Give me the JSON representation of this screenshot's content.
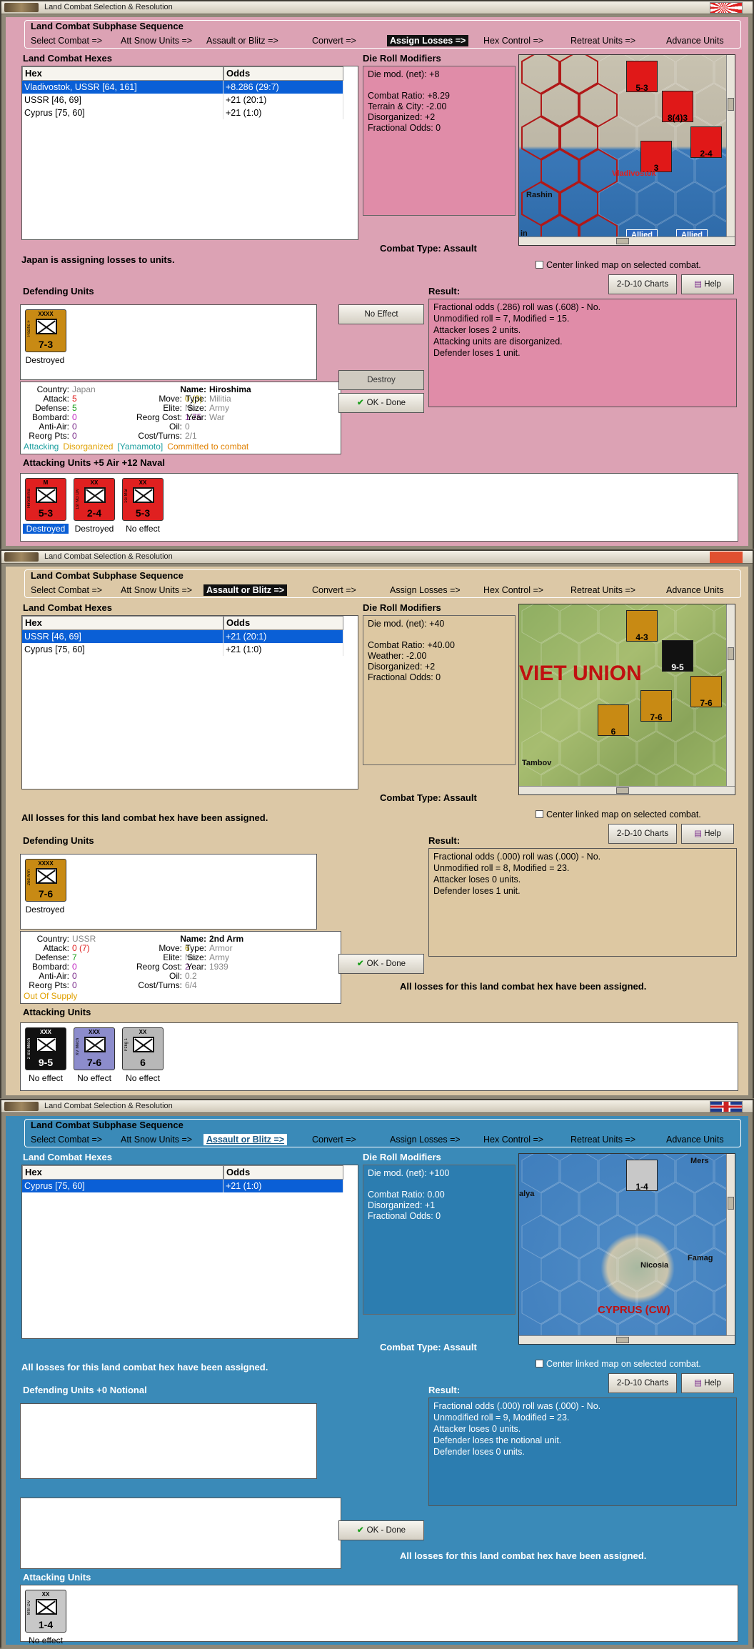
{
  "common": {
    "window_title": "Land Combat Selection & Resolution",
    "sequence_title": "Land Combat Subphase Sequence",
    "steps": [
      "Select Combat =>",
      "Att Snow Units =>",
      "Assault or Blitz =>",
      "Convert =>",
      "Assign Losses =>",
      "Hex Control =>",
      "Retreat Units =>",
      "Advance Units"
    ],
    "hexes_title": "Land Combat Hexes",
    "col_hex": "Hex",
    "col_odds": "Odds",
    "drm_title": "Die Roll Modifiers",
    "center_link": "Center linked map on selected combat.",
    "charts_btn": "2-D-10 Charts",
    "help_btn": "Help",
    "result_title": "Result:",
    "ok_btn": "OK - Done",
    "all_assigned": "All losses for this land combat hex have been assigned."
  },
  "panels": [
    {
      "theme": "pink",
      "flag": "japan",
      "active_step": 4,
      "hexes": [
        {
          "hex": "Vladivostok, USSR [64, 161]",
          "odds": "+8.286 (29:7)",
          "selected": true
        },
        {
          "hex": "USSR [46, 69]",
          "odds": "+21 (20:1)",
          "selected": false
        },
        {
          "hex": "Cyprus [75, 60]",
          "odds": "+21 (1:0)",
          "selected": false
        }
      ],
      "drm": [
        "Die mod. (net): +8",
        "",
        "Combat Ratio: +8.29",
        "Terrain & City: -2.00",
        "Disorganized: +2",
        "Fractional Odds: 0"
      ],
      "combat_type": "Combat Type:  Assault",
      "status": "Japan is assigning losses to units.",
      "defending_title": "Defending Units",
      "defenders": [
        {
          "size": "XXXX",
          "strength": "7-3",
          "label": "Destroyed",
          "color": "#c88a14",
          "side": "Pacific F"
        }
      ],
      "info": {
        "country_lbl": "Country:",
        "country": "Japan",
        "attack_lbl": "Attack:",
        "attack": "5",
        "defense_lbl": "Defense:",
        "defense": "5",
        "bombard_lbl": "Bombard:",
        "bombard": "0",
        "antiair_lbl": "Anti-Air:",
        "antiair": "0",
        "reorg_lbl": "Reorg Pts:",
        "reorg": "0",
        "move_lbl": "Move:",
        "move": "0 (3)",
        "elite_lbl": "Elite:",
        "elite": "No",
        "reorgcost_lbl": "Reorg Cost:",
        "reorgcost": "1.75",
        "oil_lbl": "Oil:",
        "oil": "0",
        "cost_lbl": "Cost/Turns:",
        "cost": "2/1",
        "name_lbl": "Name:",
        "name": "Hiroshima",
        "type_lbl": "Type:",
        "type": "Militia",
        "size_lbl": "Size:",
        "size": "Army",
        "year_lbl": "Year:",
        "year": "War",
        "footer": [
          "Attacking",
          "Disorganized",
          "[Yamamoto]",
          "Committed to combat"
        ]
      },
      "result": [
        "Fractional odds (.286) roll was (.608)  -  No.",
        "Unmodified roll = 7, Modified = 15.",
        "Attacker loses 2 units.",
        "Attacking units are disorganized.",
        "Defender loses 1 unit."
      ],
      "buttons": {
        "no_effect": "No Effect",
        "destroy": "Destroy"
      },
      "attacking_title": "Attacking Units +5 Air +12 Naval",
      "attackers": [
        {
          "size": "M",
          "strength": "5-3",
          "label": "Destroyed",
          "color": "#e02020",
          "hl": true,
          "side": "Hiroshima"
        },
        {
          "size": "XX",
          "strength": "2-4",
          "label": "Destroyed",
          "color": "#e02020",
          "hl": false,
          "side": "1st NG Div"
        },
        {
          "size": "XX",
          "strength": "5-3",
          "label": "No effect",
          "color": "#e02020",
          "hl": false,
          "side": "1G Mar"
        }
      ],
      "map": {
        "labels": [
          "Rashin",
          "Vladivostok",
          "Allied",
          "Allied",
          "in"
        ],
        "counters": [
          "5-3",
          "8(4)3",
          "2-4",
          "3"
        ]
      }
    },
    {
      "theme": "tan",
      "flag": "none",
      "active_step": 2,
      "hexes": [
        {
          "hex": "USSR [46, 69]",
          "odds": "+21 (20:1)",
          "selected": true
        },
        {
          "hex": "Cyprus [75, 60]",
          "odds": "+21 (1:0)",
          "selected": false
        }
      ],
      "drm": [
        "Die mod. (net): +40",
        "",
        "Combat Ratio: +40.00",
        "Weather: -2.00",
        "Disorganized: +2",
        "Fractional Odds: 0"
      ],
      "combat_type": "Combat Type:  Assault",
      "status": "All losses for this land combat hex have been assigned.",
      "defending_title": "Defending Units",
      "defenders": [
        {
          "size": "XXXX",
          "strength": "7-6",
          "label": "Destroyed",
          "color": "#c88a14",
          "side": "2nd Arm"
        }
      ],
      "info": {
        "country_lbl": "Country:",
        "country": "USSR",
        "attack_lbl": "Attack:",
        "attack": "0 (7)",
        "defense_lbl": "Defense:",
        "defense": "7",
        "bombard_lbl": "Bombard:",
        "bombard": "0",
        "antiair_lbl": "Anti-Air:",
        "antiair": "0",
        "reorg_lbl": "Reorg Pts:",
        "reorg": "0",
        "move_lbl": "Move:",
        "move": "6",
        "elite_lbl": "Elite:",
        "elite": "No",
        "reorgcost_lbl": "Reorg Cost:",
        "reorgcost": "2",
        "oil_lbl": "Oil:",
        "oil": "0.2",
        "cost_lbl": "Cost/Turns:",
        "cost": "6/4",
        "name_lbl": "Name:",
        "name": "2nd Arm",
        "type_lbl": "Type:",
        "type": "Armor",
        "size_lbl": "Size:",
        "size": "Army",
        "year_lbl": "Year:",
        "year": "1939",
        "footer": [
          "Out Of Supply",
          "",
          "",
          ""
        ]
      },
      "result": [
        "Fractional odds (.000) roll was (.000)  -  No.",
        "Unmodified roll = 8, Modified = 23.",
        "Attacker loses 0 units.",
        "Defender loses 1 unit."
      ],
      "buttons": {
        "no_effect": "",
        "destroy": ""
      },
      "attacking_title": "Attacking Units",
      "attackers": [
        {
          "size": "XXX",
          "strength": "9-5",
          "label": "No effect",
          "color": "#111111",
          "hl": false,
          "side": "2 SS Mech"
        },
        {
          "size": "XXX",
          "strength": "7-6",
          "label": "No effect",
          "color": "#8c8ccc",
          "hl": false,
          "side": "XV Mech"
        },
        {
          "size": "XX",
          "strength": "6",
          "label": "No effect",
          "color": "#b8b8b8",
          "hl": false,
          "side": "Pzkg 1"
        }
      ],
      "map": {
        "labels": [
          "VIET UNION",
          "Tambov"
        ],
        "counters": [
          "4-3",
          "9-5",
          "7-6",
          "7-6",
          "6"
        ]
      }
    },
    {
      "theme": "blue",
      "flag": "uk",
      "active_step": 2,
      "hexes": [
        {
          "hex": "Cyprus [75, 60]",
          "odds": "+21 (1:0)",
          "selected": true
        }
      ],
      "drm": [
        "Die mod. (net): +100",
        "",
        "Combat Ratio: 0.00",
        "Disorganized: +1",
        "Fractional Odds: 0"
      ],
      "combat_type": "Combat Type:  Assault",
      "status": "All losses for this land combat hex have been assigned.",
      "defending_title": "Defending Units +0 Notional",
      "defenders": [],
      "info": null,
      "result": [
        "Fractional odds (.000) roll was (.000)  -  No.",
        "Unmodified roll = 9, Modified = 23.",
        "Attacker loses 0 units.",
        "Defender loses the notional unit.",
        "Defender loses 0 units."
      ],
      "buttons": {
        "no_effect": "",
        "destroy": ""
      },
      "attacking_title": "Attacking Units",
      "attackers": [
        {
          "size": "XX",
          "strength": "1-4",
          "label": "No effect",
          "color": "#c8c8c8",
          "hl": false,
          "side": "Mtn Div"
        }
      ],
      "map": {
        "labels": [
          "Mers",
          "alya",
          "Nicosia",
          "Famag",
          "CYPRUS (CW)"
        ],
        "counters": [
          "1-4"
        ]
      }
    }
  ]
}
